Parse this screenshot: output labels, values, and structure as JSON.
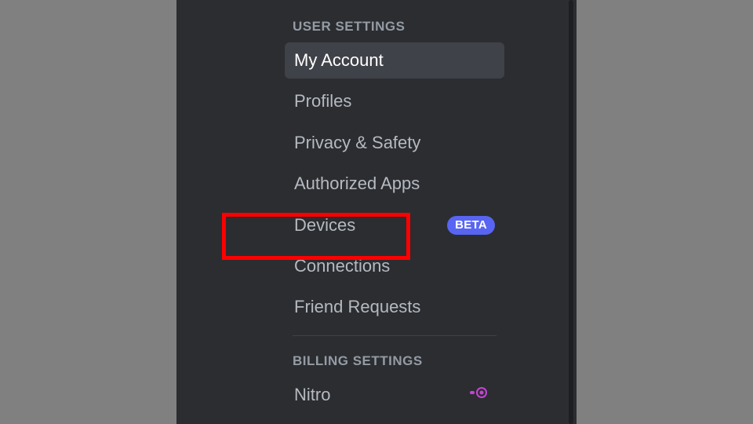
{
  "sections": {
    "user_settings": {
      "header": "USER SETTINGS",
      "items": [
        {
          "label": "My Account",
          "selected": true
        },
        {
          "label": "Profiles"
        },
        {
          "label": "Privacy & Safety"
        },
        {
          "label": "Authorized Apps"
        },
        {
          "label": "Devices",
          "badge": "BETA",
          "highlighted": true
        },
        {
          "label": "Connections"
        },
        {
          "label": "Friend Requests"
        }
      ]
    },
    "billing_settings": {
      "header": "BILLING SETTINGS",
      "items": [
        {
          "label": "Nitro",
          "icon": "nitro"
        }
      ]
    }
  },
  "badge_text": "BETA"
}
